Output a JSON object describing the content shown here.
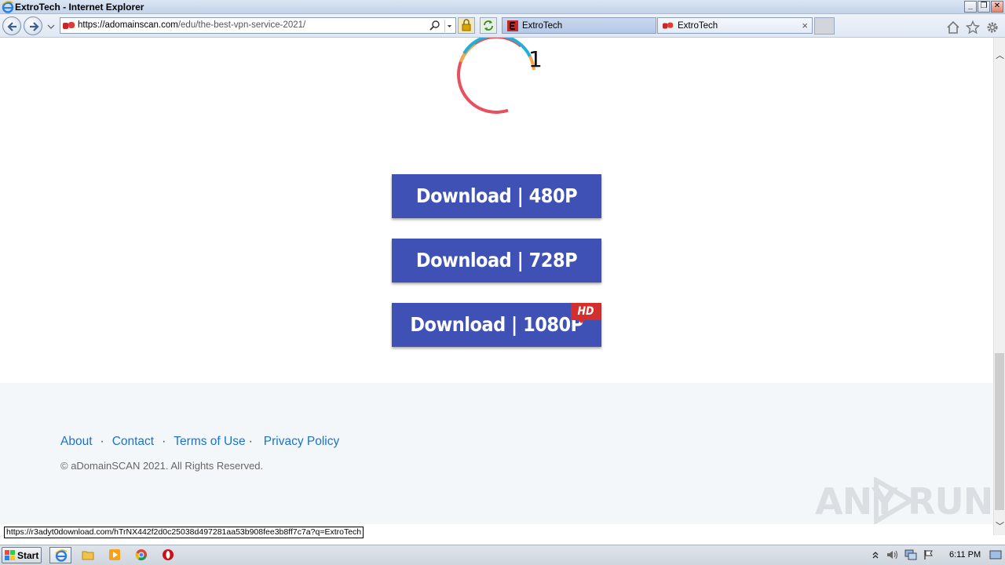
{
  "window": {
    "title": "ExtroTech - Internet Explorer",
    "controls": {
      "minimize": "_",
      "restore": "❐",
      "close": "✕"
    }
  },
  "browser": {
    "address": {
      "url_host": "https://adomainscan.com",
      "url_path": "/edu/the-best-vpn-service-2021/"
    },
    "tabs": [
      {
        "label": "ExtroTech",
        "active": false,
        "icon": "extrotech-favicon-icon"
      },
      {
        "label": "ExtroTech",
        "active": true,
        "icon": "adomainscan-favicon-icon",
        "close": "×"
      }
    ]
  },
  "page": {
    "counter": "1",
    "downloads": [
      {
        "label": "Download | 480P"
      },
      {
        "label": "Download | 728P"
      },
      {
        "label": "Download | 1080P",
        "badge": "HD"
      }
    ],
    "colors": {
      "button_bg": "#3f51b5",
      "badge_red": "#d32f2f",
      "link": "#1a73c9"
    },
    "footer": {
      "links": [
        "About",
        "Contact",
        "Terms of Use",
        "Privacy Policy"
      ],
      "separator": "·",
      "copyright": "© aDomainSCAN 2021. All Rights Reserved."
    },
    "watermark": {
      "left": "ANY",
      "right": "RUN"
    }
  },
  "status": {
    "hover_url": "https://r3adyt0download.com/hTrNX442f2d0c25038d497281aa53b908fee3b8ff7c7a?q=ExtroTech"
  },
  "taskbar": {
    "start_label": "Start",
    "clock": "6:11 PM"
  }
}
